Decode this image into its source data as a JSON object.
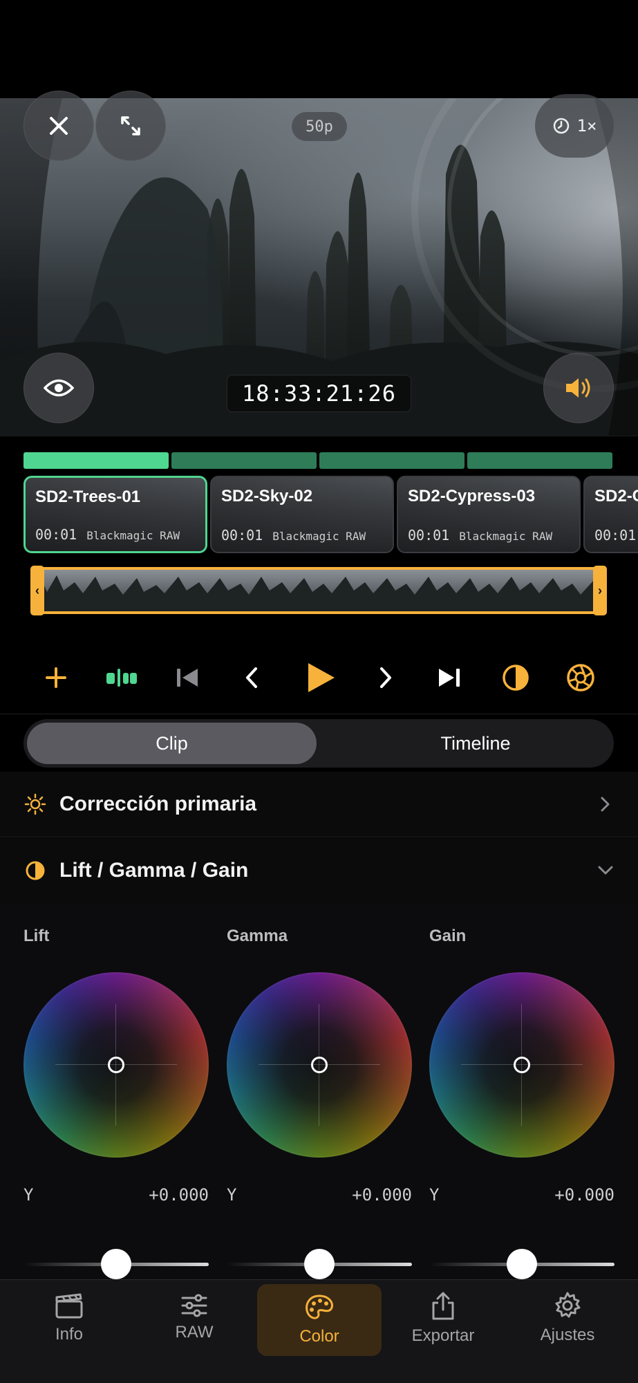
{
  "viewer": {
    "fps_badge": "50p",
    "speed": "1×",
    "timecode": "18:33:21:26",
    "icons": [
      "close-icon",
      "expand-icon",
      "clock-icon",
      "eye-icon",
      "speaker-icon"
    ]
  },
  "progress": {
    "segments": 4,
    "active_index": 0
  },
  "clips": [
    {
      "name": "SD2-Trees-01",
      "duration": "00:01",
      "codec": "Blackmagic RAW",
      "selected": true
    },
    {
      "name": "SD2-Sky-02",
      "duration": "00:01",
      "codec": "Blackmagic RAW",
      "selected": false
    },
    {
      "name": "SD2-Cypress-03",
      "duration": "00:01",
      "codec": "Blackmagic RAW",
      "selected": false
    },
    {
      "name": "SD2-C",
      "duration": "00:01",
      "codec": "",
      "selected": false
    }
  ],
  "transport": {
    "icons": [
      "add-icon",
      "split-icon",
      "skip-start-icon",
      "prev-frame-icon",
      "play-icon",
      "next-frame-icon",
      "skip-end-icon",
      "contrast-icon",
      "aperture-icon"
    ]
  },
  "scope_toggle": {
    "clip_label": "Clip",
    "timeline_label": "Timeline",
    "selected": "Clip"
  },
  "sections": {
    "primary": {
      "title": "Corrección primaria",
      "icon": "sun-icon"
    },
    "lgg": {
      "title": "Lift / Gamma / Gain",
      "icon": "half-circle-icon"
    }
  },
  "wheels": [
    {
      "label": "Lift",
      "y_label": "Y",
      "y_value": "+0.000"
    },
    {
      "label": "Gamma",
      "y_label": "Y",
      "y_value": "+0.000"
    },
    {
      "label": "Gain",
      "y_label": "Y",
      "y_value": "+0.000"
    }
  ],
  "tabs": [
    {
      "label": "Info",
      "icon": "clapperboard-icon"
    },
    {
      "label": "RAW",
      "icon": "sliders-icon"
    },
    {
      "label": "Color",
      "icon": "palette-icon",
      "active": true
    },
    {
      "label": "Exportar",
      "icon": "share-icon"
    },
    {
      "label": "Ajustes",
      "icon": "gear-icon"
    }
  ],
  "colors": {
    "accent": "#f7b23b",
    "green": "#4fd690",
    "green_dark": "#2e7d58"
  }
}
